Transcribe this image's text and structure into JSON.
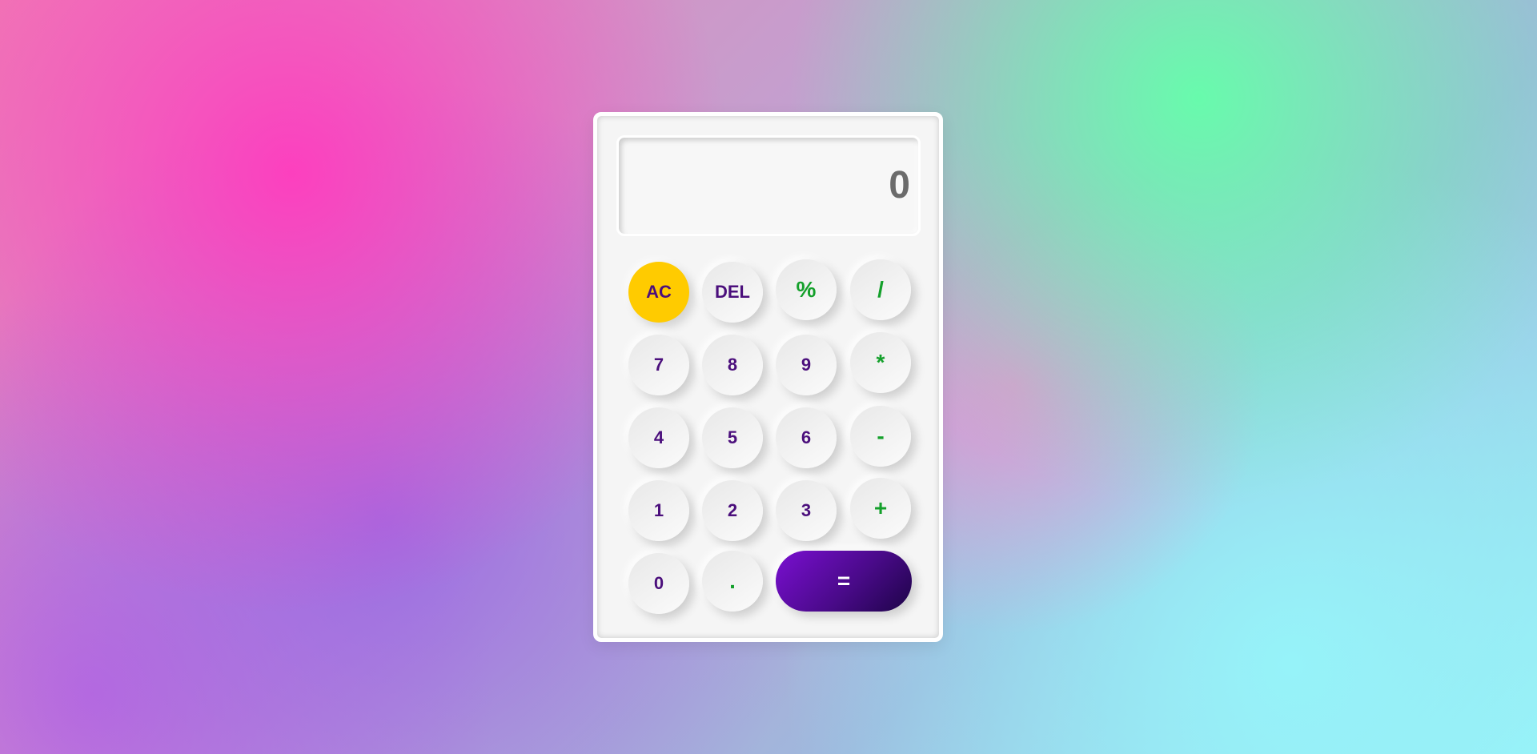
{
  "display": {
    "value": "0"
  },
  "buttons": {
    "ac": "AC",
    "del": "DEL",
    "percent": "%",
    "divide": "/",
    "seven": "7",
    "eight": "8",
    "nine": "9",
    "multiply": "*",
    "four": "4",
    "five": "5",
    "six": "6",
    "subtract": "-",
    "one": "1",
    "two": "2",
    "three": "3",
    "add": "+",
    "zero": "0",
    "decimal": ".",
    "equals": "="
  },
  "colors": {
    "ac_button": "#ffcb00",
    "number_text": "#4b0f7c",
    "operator_text": "#14a02b",
    "equals_gradient_start": "#7a0fd1",
    "equals_gradient_end": "#1d0447",
    "display_text": "#6b6b6b",
    "calculator_body": "#f5f5f5"
  }
}
